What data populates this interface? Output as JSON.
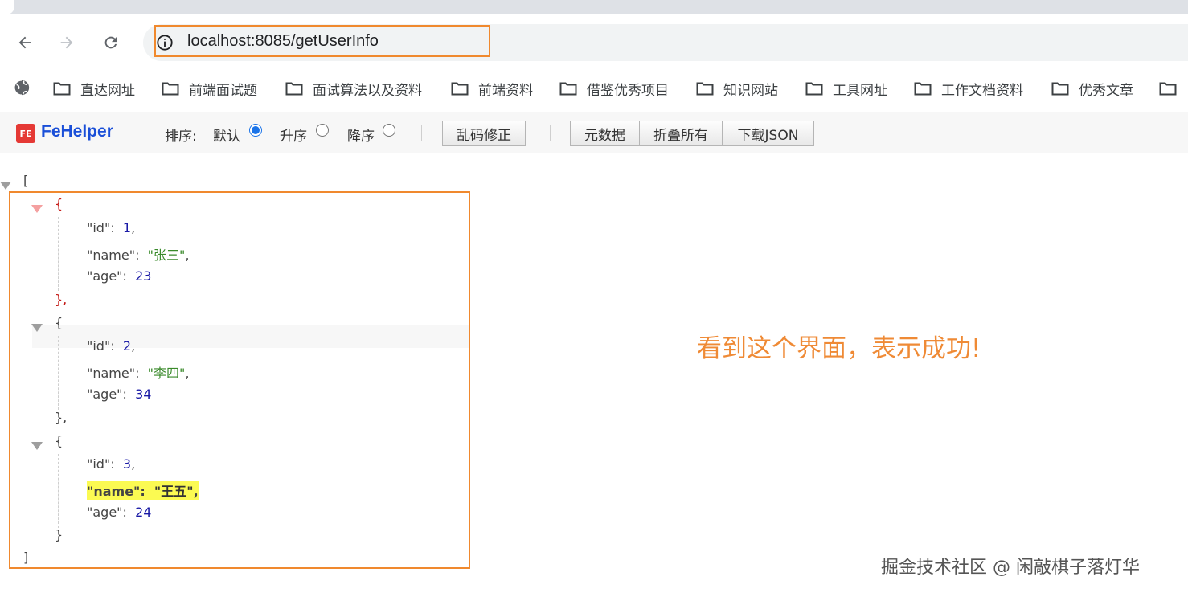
{
  "browser": {
    "url": "localhost:8085/getUserInfo",
    "bookmarks": [
      "直达网址",
      "前端面试题",
      "面试算法以及资料",
      "前端资料",
      "借鉴优秀项目",
      "知识网站",
      "工具网址",
      "工作文档资料",
      "优秀文章"
    ]
  },
  "fehelper": {
    "logo_text": "FE",
    "title": "FeHelper",
    "sort_label": "排序:",
    "sort_options": [
      {
        "label": "默认",
        "selected": true
      },
      {
        "label": "升序",
        "selected": false
      },
      {
        "label": "降序",
        "selected": false
      }
    ],
    "fix_button": "乱码修正",
    "meta_button": "元数据",
    "fold_button": "折叠所有",
    "download_button": "下载JSON"
  },
  "json": {
    "open_bracket": "[",
    "close_bracket": "]",
    "open_brace": "{",
    "close_brace_comma": "},",
    "close_brace": "}",
    "records": [
      {
        "id": "1",
        "name": "\"张三\"",
        "age": "23"
      },
      {
        "id": "2",
        "name": "\"李四\"",
        "age": "34"
      },
      {
        "id": "3",
        "name": "\"王五\"",
        "age": "24"
      }
    ],
    "key_id": "\"id\":",
    "key_name": "\"name\":",
    "key_age": "\"age\":"
  },
  "annotation": {
    "success_text": "看到这个界面，表示成功!",
    "watermark": "掘金技术社区 @ 闲敲棋子落灯华"
  },
  "colors": {
    "highlight_border": "#f0892e",
    "annotation": "#ef8a35",
    "fehelper_title": "#1a4fd8"
  }
}
